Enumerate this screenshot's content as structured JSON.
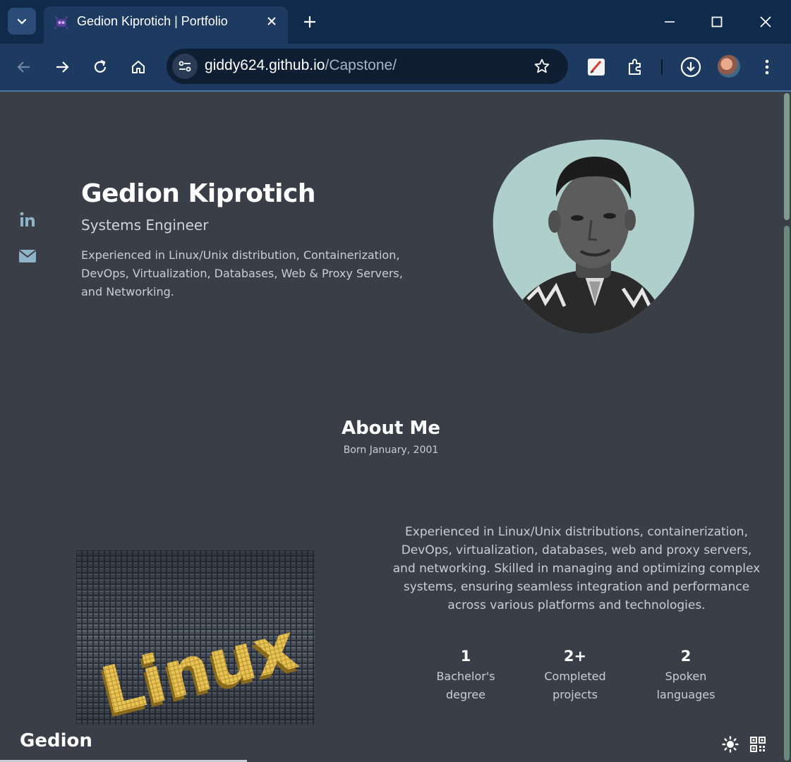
{
  "browser": {
    "tab_title": "Gedion Kiprotich | Portfolio",
    "url_host": "giddy624.github.io",
    "url_path": "/Capstone/",
    "icons": [
      "chevron-down-icon",
      "favicon-icon",
      "close-icon",
      "plus-icon",
      "minimize-icon",
      "maximize-icon",
      "window-close-icon",
      "back-icon",
      "forward-icon",
      "reload-icon",
      "home-icon",
      "site-info-icon",
      "star-icon",
      "pdf-editor-extension-icon",
      "extensions-icon",
      "download-icon",
      "profile-avatar",
      "more-icon"
    ]
  },
  "hero": {
    "name": "Gedion Kiprotich",
    "role": "Systems Engineer",
    "description": "Experienced in Linux/Unix distribution, Containerization, DevOps, Virtualization, Databases, Web & Proxy Servers, and Networking.",
    "social_icons": [
      "linkedin-icon",
      "email-icon"
    ]
  },
  "about": {
    "title": "About Me",
    "subtitle": "Born January, 2001",
    "image_text": "Linux",
    "description": "Experienced in Linux/Unix distributions, containerization, DevOps, virtualization, databases, web and proxy servers, and networking. Skilled in managing and optimizing complex systems, ensuring seamless integration and performance across various platforms and technologies.",
    "stats": [
      {
        "number": "1",
        "label_line1": "Bachelor's",
        "label_line2": "degree"
      },
      {
        "number": "2+",
        "label_line1": "Completed",
        "label_line2": "projects"
      },
      {
        "number": "2",
        "label_line1": "Spoken",
        "label_line2": "languages"
      }
    ]
  },
  "footer": {
    "brand": "Gedion",
    "icons": [
      "theme-toggle-sun-icon",
      "qr-code-icon"
    ]
  },
  "colors": {
    "page_bg": "#3a3f47",
    "blob": "#aecfca",
    "tabbar": "#0f2a4a",
    "toolbar": "#1d3a60",
    "linux_letters": "#e8c455"
  }
}
